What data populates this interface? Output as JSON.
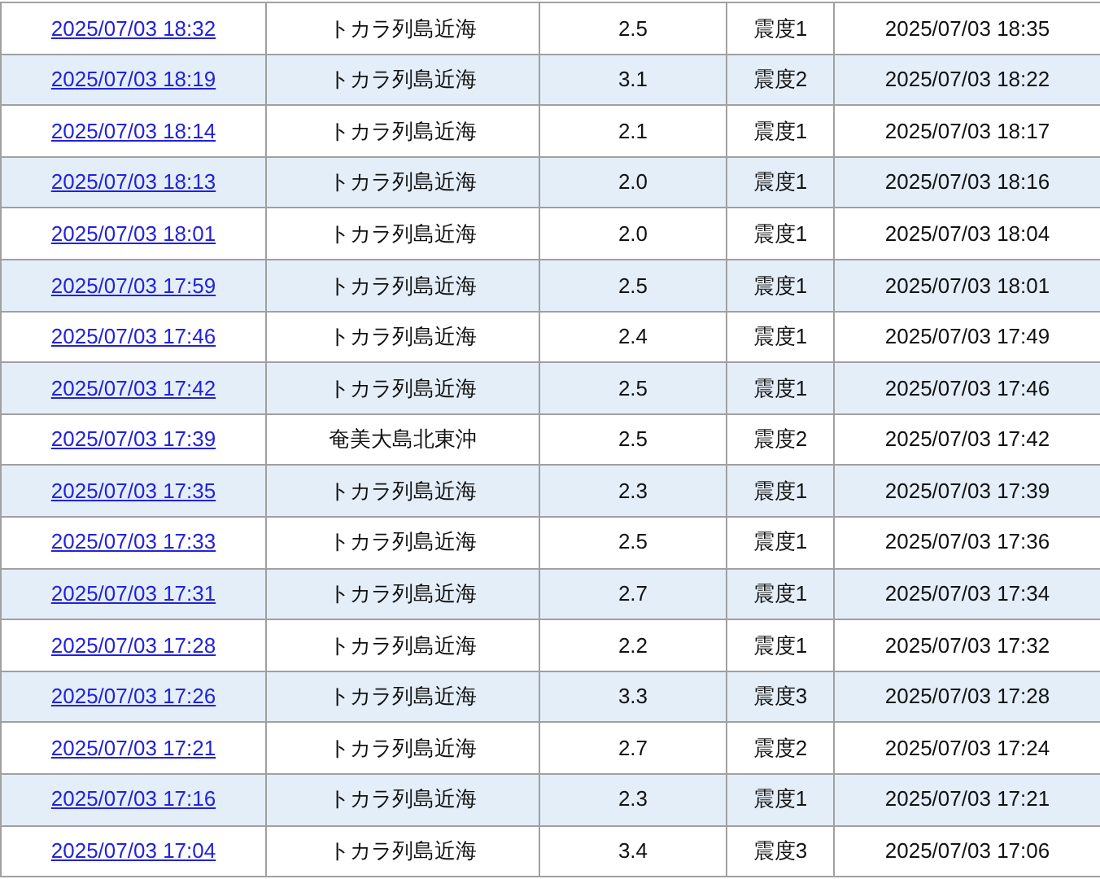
{
  "rows": [
    {
      "time": "2025/07/03 18:32",
      "place": "トカラ列島近海",
      "magnitude": "2.5",
      "intensity": "震度1",
      "announced": "2025/07/03 18:35"
    },
    {
      "time": "2025/07/03 18:19",
      "place": "トカラ列島近海",
      "magnitude": "3.1",
      "intensity": "震度2",
      "announced": "2025/07/03 18:22"
    },
    {
      "time": "2025/07/03 18:14",
      "place": "トカラ列島近海",
      "magnitude": "2.1",
      "intensity": "震度1",
      "announced": "2025/07/03 18:17"
    },
    {
      "time": "2025/07/03 18:13",
      "place": "トカラ列島近海",
      "magnitude": "2.0",
      "intensity": "震度1",
      "announced": "2025/07/03 18:16"
    },
    {
      "time": "2025/07/03 18:01",
      "place": "トカラ列島近海",
      "magnitude": "2.0",
      "intensity": "震度1",
      "announced": "2025/07/03 18:04"
    },
    {
      "time": "2025/07/03 17:59",
      "place": "トカラ列島近海",
      "magnitude": "2.5",
      "intensity": "震度1",
      "announced": "2025/07/03 18:01"
    },
    {
      "time": "2025/07/03 17:46",
      "place": "トカラ列島近海",
      "magnitude": "2.4",
      "intensity": "震度1",
      "announced": "2025/07/03 17:49"
    },
    {
      "time": "2025/07/03 17:42",
      "place": "トカラ列島近海",
      "magnitude": "2.5",
      "intensity": "震度1",
      "announced": "2025/07/03 17:46"
    },
    {
      "time": "2025/07/03 17:39",
      "place": "奄美大島北東沖",
      "magnitude": "2.5",
      "intensity": "震度2",
      "announced": "2025/07/03 17:42"
    },
    {
      "time": "2025/07/03 17:35",
      "place": "トカラ列島近海",
      "magnitude": "2.3",
      "intensity": "震度1",
      "announced": "2025/07/03 17:39"
    },
    {
      "time": "2025/07/03 17:33",
      "place": "トカラ列島近海",
      "magnitude": "2.5",
      "intensity": "震度1",
      "announced": "2025/07/03 17:36"
    },
    {
      "time": "2025/07/03 17:31",
      "place": "トカラ列島近海",
      "magnitude": "2.7",
      "intensity": "震度1",
      "announced": "2025/07/03 17:34"
    },
    {
      "time": "2025/07/03 17:28",
      "place": "トカラ列島近海",
      "magnitude": "2.2",
      "intensity": "震度1",
      "announced": "2025/07/03 17:32"
    },
    {
      "time": "2025/07/03 17:26",
      "place": "トカラ列島近海",
      "magnitude": "3.3",
      "intensity": "震度3",
      "announced": "2025/07/03 17:28"
    },
    {
      "time": "2025/07/03 17:21",
      "place": "トカラ列島近海",
      "magnitude": "2.7",
      "intensity": "震度2",
      "announced": "2025/07/03 17:24"
    },
    {
      "time": "2025/07/03 17:16",
      "place": "トカラ列島近海",
      "magnitude": "2.3",
      "intensity": "震度1",
      "announced": "2025/07/03 17:21"
    },
    {
      "time": "2025/07/03 17:04",
      "place": "トカラ列島近海",
      "magnitude": "3.4",
      "intensity": "震度3",
      "announced": "2025/07/03 17:06"
    }
  ]
}
